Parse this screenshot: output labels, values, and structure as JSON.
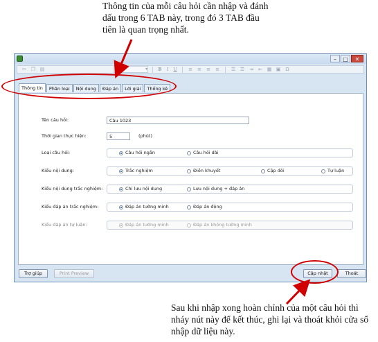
{
  "annotations": {
    "top_note": "Thông tin của mỗi câu hỏi cần nhập và đánh dấu trong 6 TAB này, trong đó 3 TAB đầu tiên là quan trọng nhất.",
    "bottom_note": "Sau khi nhập xong hoàn chỉnh của một câu hỏi thì nháy nút này để kết thúc, ghi lại và thoát khỏi cửa sổ nhập dữ liệu này.",
    "highlight_color": "#d00000"
  },
  "window": {
    "controls": {
      "minimize": "–",
      "maximize": "□",
      "close": "✕"
    }
  },
  "toolbar": {
    "bold": "B",
    "italic": "I",
    "underline": "U"
  },
  "tabs": [
    {
      "label": "Thông tin",
      "active": true
    },
    {
      "label": "Phân loại",
      "active": false
    },
    {
      "label": "Nội dung",
      "active": false
    },
    {
      "label": "Đáp án",
      "active": false
    },
    {
      "label": "Lời giải",
      "active": false
    },
    {
      "label": "Thống kê",
      "active": false
    }
  ],
  "form": {
    "question_name": {
      "label": "Tên câu hỏi:",
      "value": "Câu 1023"
    },
    "time": {
      "label": "Thời gian thực hiện:",
      "value": "5",
      "unit": "(phút)"
    },
    "question_type": {
      "label": "Loại câu hỏi:",
      "options": [
        "Câu hỏi ngắn",
        "Câu hỏi dài"
      ],
      "selected": 0
    },
    "content_type": {
      "label": "Kiểu nội dung:",
      "options": [
        "Trắc nghiệm",
        "Điền khuyết",
        "Cặp đôi",
        "Tự luận"
      ],
      "selected": 0
    },
    "mc_content_type": {
      "label": "Kiểu nội dung trắc nghiệm:",
      "options": [
        "Chỉ lưu nội dung",
        "Lưu nội dung + đáp án"
      ],
      "selected": 0
    },
    "mc_answer_type": {
      "label": "Kiểu đáp án trắc nghiệm:",
      "options": [
        "Đáp án tường minh",
        "Đáp án động"
      ],
      "selected": 0
    },
    "essay_answer_type": {
      "label": "Kiểu đáp án tự luận:",
      "options": [
        "Đáp án tường minh",
        "Đáp án không tường minh"
      ],
      "selected": 0,
      "disabled": true
    }
  },
  "buttons": {
    "help": "Trợ giúp",
    "print_preview": "Print Preview",
    "update": "Cập nhật",
    "exit": "Thoát"
  }
}
